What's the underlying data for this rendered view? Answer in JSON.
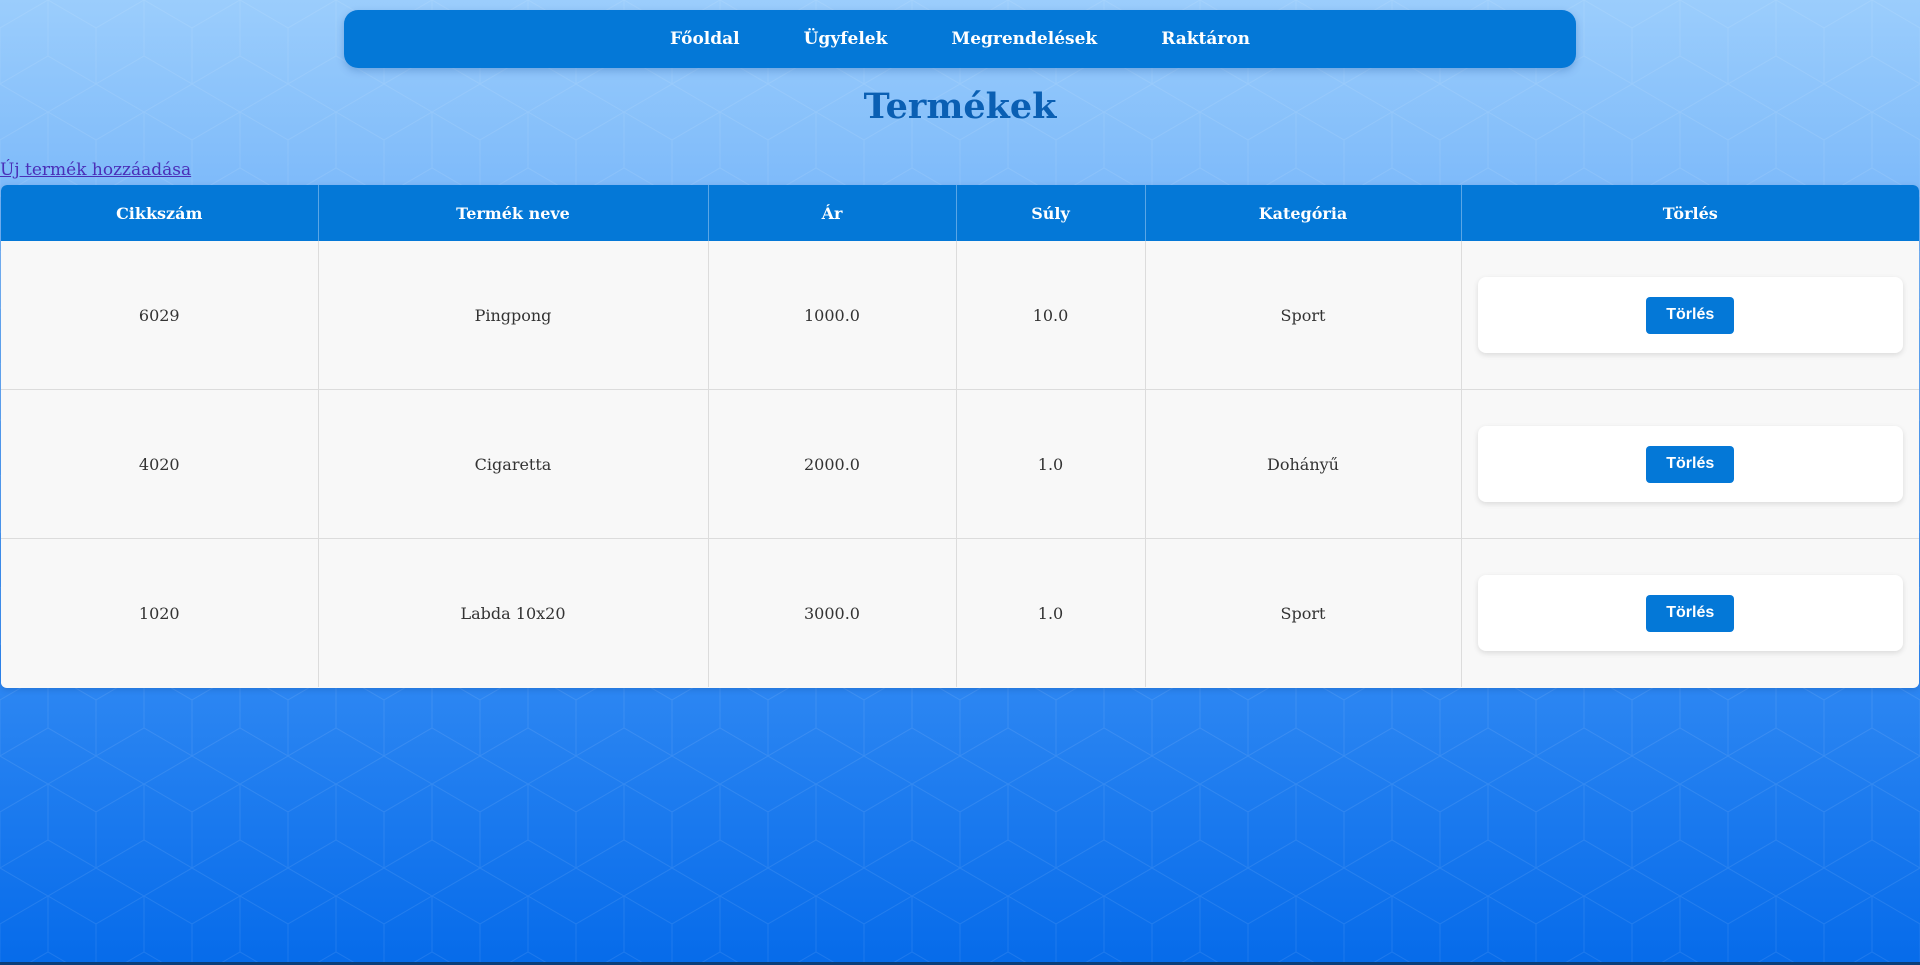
{
  "nav": {
    "items": [
      {
        "label": "Főoldal"
      },
      {
        "label": "Ügyfelek"
      },
      {
        "label": "Megrendelések"
      },
      {
        "label": "Raktáron"
      }
    ]
  },
  "page": {
    "title": "Termékek",
    "add_link": "Új termék hozzáadása"
  },
  "table": {
    "headers": [
      "Cikkszám",
      "Termék neve",
      "Ár",
      "Súly",
      "Kategória",
      "Törlés"
    ],
    "rows": [
      {
        "sku": "6029",
        "name": "Pingpong",
        "price": "1000.0",
        "weight": "10.0",
        "category": "Sport",
        "delete_label": "Törlés"
      },
      {
        "sku": "4020",
        "name": "Cigaretta",
        "price": "2000.0",
        "weight": "1.0",
        "category": "Dohányű",
        "delete_label": "Törlés"
      },
      {
        "sku": "1020",
        "name": "Labda 10x20",
        "price": "3000.0",
        "weight": "1.0",
        "category": "Sport",
        "delete_label": "Törlés"
      }
    ]
  },
  "colors": {
    "accent": "#0478d7",
    "title": "#0a5fb3",
    "link": "#4a2fb8",
    "background_top": "#9bcdfc",
    "background_bottom": "#066bea"
  }
}
